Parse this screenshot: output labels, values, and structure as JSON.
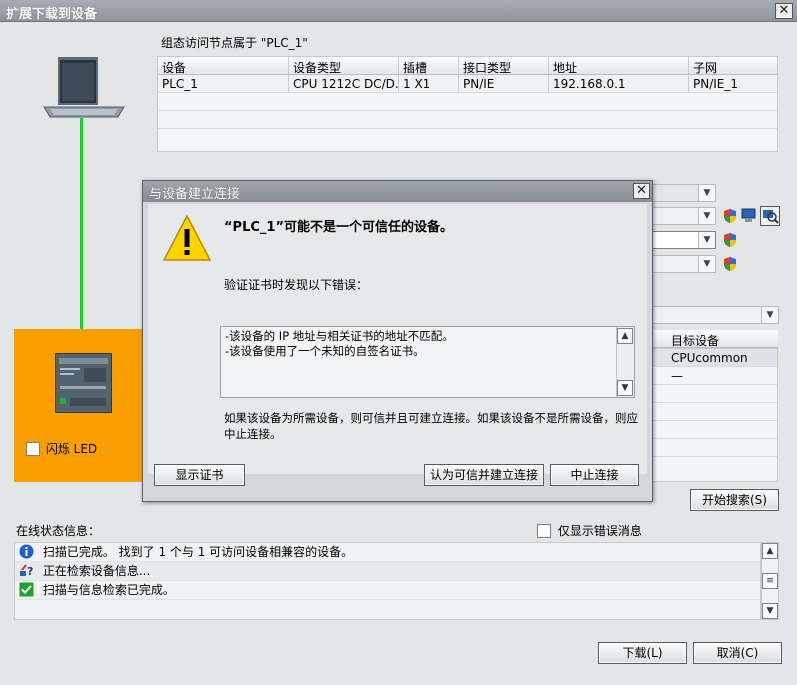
{
  "window": {
    "title": "扩展下载到设备"
  },
  "target": {
    "label": "组态访问节点属于 \"PLC_1\"",
    "columns": [
      "设备",
      "设备类型",
      "插槽",
      "接口类型",
      "地址",
      "子网"
    ],
    "rows": [
      [
        "PLC_1",
        "CPU 1212C DC/D...",
        "1 X1",
        "PN/IE",
        "192.168.0.1",
        "PN/IE_1"
      ]
    ]
  },
  "device_panel": {
    "flash_led_label": "闪烁 LED"
  },
  "target_devices": {
    "header": "目标设备",
    "rows": [
      "CPUcommon",
      "—"
    ]
  },
  "start_search_label": "开始搜索(S)",
  "status": {
    "label": "在线状态信息：",
    "only_errors_label": "仅显示错误消息",
    "messages": [
      {
        "icon": "info-icon",
        "text": "扫描已完成。 找到了 1 个与 1 可访问设备相兼容的设备。"
      },
      {
        "icon": "search-info-icon",
        "text": "正在检索设备信息..."
      },
      {
        "icon": "check-icon",
        "text": "扫描与信息检索已完成。"
      }
    ]
  },
  "footer": {
    "download_label": "下载(L)",
    "cancel_label": "取消(C)"
  },
  "dialog": {
    "title": "与设备建立连接",
    "headline": "“PLC_1”可能不是一个可信任的设备。",
    "subtitle": "验证证书时发现以下错误：",
    "errors": [
      "-该设备的 IP 地址与相关证书的地址不匹配。",
      "-该设备使用了一个未知的自签名证书。"
    ],
    "note": "如果该设备为所需设备，则可信并且可建立连接。如果该设备不是所需设备，则应中止连接。",
    "show_cert_label": "显示证书",
    "trust_label": "认为可信并建立连接",
    "abort_label": "中止连接"
  },
  "colors": {
    "link_line": "#19d128",
    "device_panel": "#f9a000",
    "info": "#1f5fd1",
    "ok": "#1fa12e",
    "warning": "#ffd200"
  }
}
